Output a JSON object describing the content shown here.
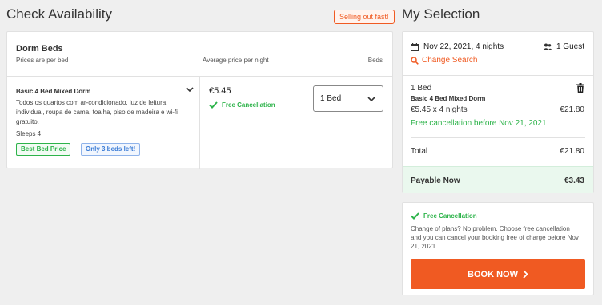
{
  "header": {
    "left_title": "Check Availability",
    "selling_badge": "Selling out fast!",
    "right_title": "My Selection"
  },
  "rooms_table": {
    "section_title": "Dorm Beds",
    "prices_note": "Prices are per bed",
    "avg_price_header": "Average price per night",
    "beds_header": "Beds"
  },
  "room": {
    "name": "Basic 4 Bed Mixed Dorm",
    "description": "Todos os quartos com ar-condicionado, luz de leitura individual, roupa de cama, toalha, piso de madeira e wi-fi gratuito.",
    "sleeps": "Sleeps 4",
    "tag_best_price": "Best Bed Price",
    "tag_scarcity": "Only 3 beds left!",
    "price": "€5.45",
    "free_cancellation": "Free Cancellation",
    "beds_selected": "1 Bed"
  },
  "selection": {
    "dates": "Nov 22, 2021, 4 nights",
    "guests": "1 Guest",
    "change_search": "Change Search",
    "bed_count": "1 Bed",
    "room_name": "Basic 4 Bed Mixed Dorm",
    "price_calc": "€5.45 x 4 nights",
    "line_total": "€21.80",
    "free_cancel_note": "Free cancellation before Nov 21, 2021",
    "total_label": "Total",
    "total_value": "€21.80",
    "payable_label": "Payable Now",
    "payable_value": "€3.43"
  },
  "booking": {
    "free_cancel_title": "Free Cancellation",
    "info_text": "Change of plans? No problem. Choose free cancellation and you can cancel your booking free of charge before Nov 21, 2021.",
    "book_button": "BOOK NOW"
  },
  "colors": {
    "accent_orange": "#f05a22",
    "success_green": "#2db34a",
    "info_blue": "#3a7bd5",
    "page_background": "#efefef"
  },
  "icons": [
    "check-icon",
    "chevron-down-icon",
    "calendar-icon",
    "guests-icon",
    "search-icon",
    "trash-icon",
    "chevron-right-icon"
  ]
}
